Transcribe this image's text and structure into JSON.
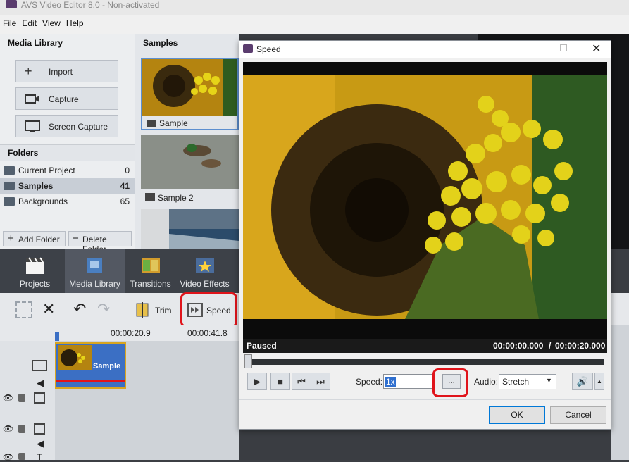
{
  "app": {
    "title": "AVS Video Editor 8.0 - Non-activated"
  },
  "menu": [
    "File",
    "Edit",
    "View",
    "Help"
  ],
  "media_library": {
    "header": "Media Library",
    "buttons": {
      "import": "Import",
      "capture": "Capture",
      "screen_capture": "Screen Capture"
    }
  },
  "folders": {
    "header": "Folders",
    "items": [
      {
        "label": "Current Project",
        "count": "0"
      },
      {
        "label": "Samples",
        "count": "41"
      },
      {
        "label": "Backgrounds",
        "count": "65"
      }
    ],
    "add": "Add Folder",
    "delete": "Delete Folder"
  },
  "samples": {
    "header": "Samples",
    "items": [
      "Sample",
      "Sample 2"
    ]
  },
  "tabs": [
    "Projects",
    "Media Library",
    "Transitions",
    "Video Effects"
  ],
  "toolbar": {
    "trim": "Trim",
    "speed": "Speed"
  },
  "timeline": {
    "ruler": [
      "00:00:20.9",
      "00:00:41.8"
    ],
    "clip": "Sample"
  },
  "dialog": {
    "title": "Speed",
    "status": "Paused",
    "time_current": "00:00:00.000",
    "time_sep": "/",
    "time_total": "00:00:20.000",
    "speed_label": "Speed:",
    "speed_value": "1x",
    "more": "...",
    "audio_label": "Audio:",
    "audio_value": "Stretch",
    "ok": "OK",
    "cancel": "Cancel"
  },
  "colors": {
    "highlight": "#e0141b",
    "clip": "#3b6fc4"
  }
}
